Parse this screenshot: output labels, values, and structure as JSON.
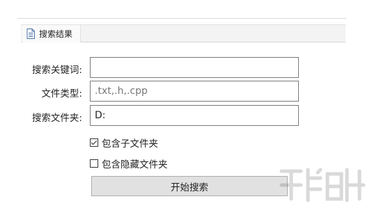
{
  "tab": {
    "label": "搜索结果",
    "icon": "document-icon"
  },
  "form": {
    "keyword": {
      "label": "搜索关键词:",
      "value": ""
    },
    "file_type": {
      "label": "文件类型:",
      "value": ".txt,.h,.cpp"
    },
    "folder": {
      "label": "搜索文件夹:",
      "value": "D:"
    },
    "include_subfolders": {
      "label": "包含子文件夹",
      "checked": true
    },
    "include_hidden": {
      "label": "包含隐藏文件夹",
      "checked": false
    },
    "search_button": {
      "label": "开始搜索"
    }
  }
}
